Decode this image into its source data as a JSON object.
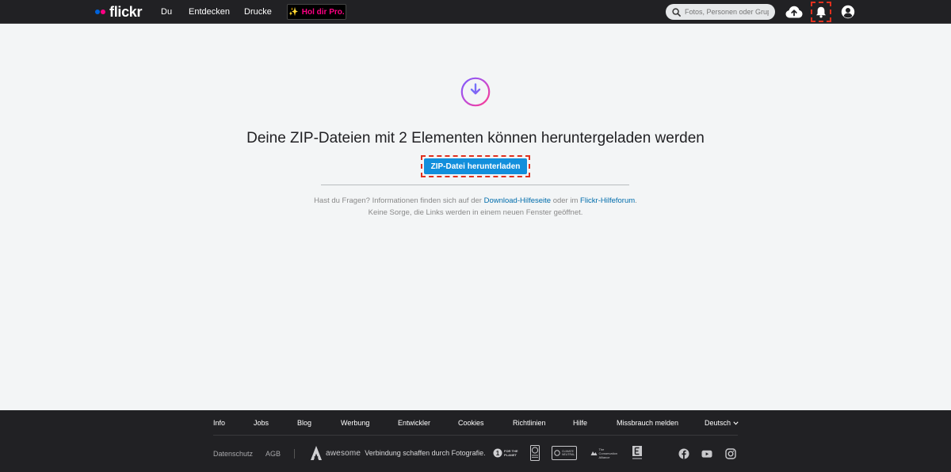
{
  "nav": {
    "logo_text": "flickr",
    "links": [
      "Du",
      "Entdecken",
      "Drucke"
    ],
    "pro_label": "Hol dir Pro.",
    "search_placeholder": "Fotos, Personen oder Gruppen",
    "icons": [
      "upload-cloud-icon",
      "notification-bell-icon",
      "account-avatar-icon"
    ]
  },
  "main": {
    "headline": "Deine ZIP-Dateien mit 2 Elementen können heruntergeladen werden",
    "button_label": "ZIP-Datei herunterladen",
    "help_prefix": "Hast du Fragen? Informationen finden sich auf der ",
    "help_link1": "Download-Hilfeseite",
    "help_middle": " oder im ",
    "help_link2": "Flickr-Hilfeforum",
    "help_suffix": ".",
    "help_line2": "Keine Sorge, die Links werden in einem neuen Fenster geöffnet."
  },
  "footer": {
    "links": [
      "Info",
      "Jobs",
      "Blog",
      "Werbung",
      "Entwickler",
      "Cookies",
      "Richtlinien",
      "Hilfe",
      "Missbrauch melden",
      "Deutsch"
    ],
    "secondary": [
      "Datenschutz",
      "AGB"
    ],
    "awesome_label": "awesome",
    "tagline": "Verbindung schaffen durch Fotografie.",
    "partner_texts": [
      "FOR THE PLANET",
      "CLIMATE NEUTRAL",
      "The Conservation Alliance"
    ],
    "social": [
      "facebook-icon",
      "youtube-icon",
      "instagram-icon"
    ]
  },
  "colors": {
    "nav_bg": "#212124",
    "accent_blue": "#128fdc",
    "link_blue": "#006dac",
    "flickr_pink": "#ff0084",
    "flickr_blue": "#0063dc",
    "highlight_red": "#e0301e"
  }
}
